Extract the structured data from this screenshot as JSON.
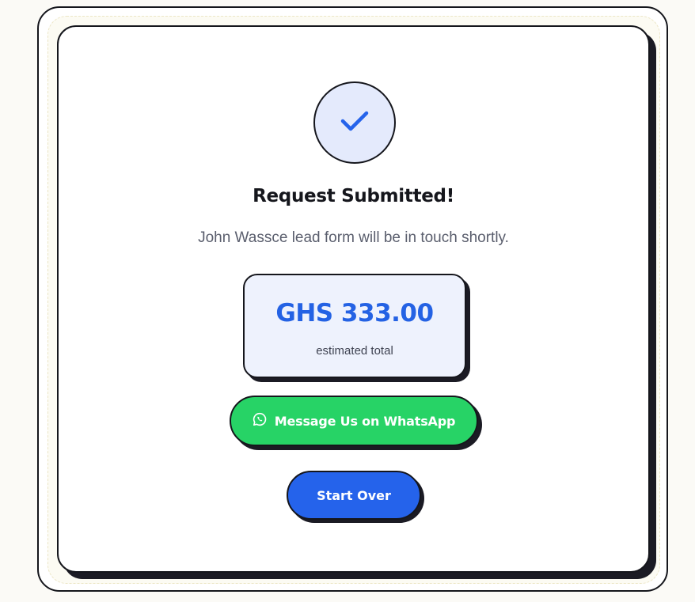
{
  "confirmation": {
    "title": "Request Submitted!",
    "message": "John Wassce lead form will be in touch shortly.",
    "status_icon": "check-icon"
  },
  "estimate": {
    "amount": "GHS 333.00",
    "label": "estimated total"
  },
  "actions": {
    "whatsapp_label": "Message Us on WhatsApp",
    "whatsapp_icon": "whatsapp-icon",
    "start_over_label": "Start Over"
  },
  "colors": {
    "accent_blue": "#2563eb",
    "whatsapp_green": "#27d366",
    "outline": "#15161c"
  }
}
